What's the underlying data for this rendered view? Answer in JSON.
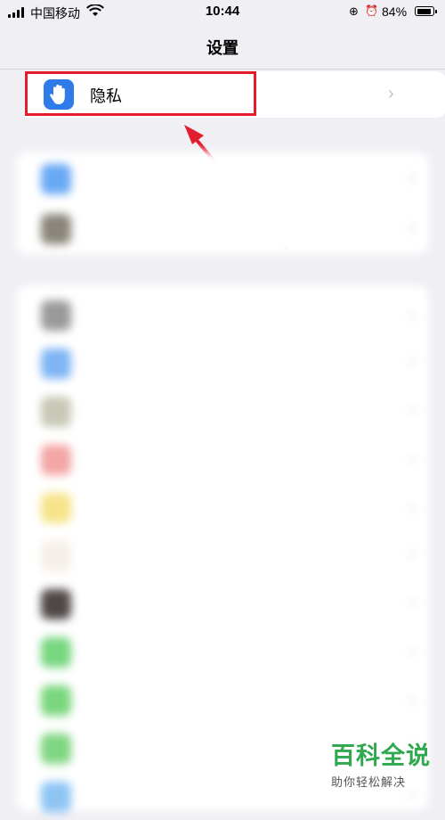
{
  "status_bar": {
    "carrier": "中国移动",
    "time": "10:44",
    "battery": "84%",
    "battery_fraction": 0.84
  },
  "nav": {
    "title": "设置"
  },
  "privacy_row": {
    "label": "隐私",
    "icon": "hand-icon",
    "icon_color": "#2f7bea"
  },
  "highlight_color": "#e31c2e",
  "blurred_sections": [
    {
      "items": [
        {
          "icon_color": "#69a8f5"
        },
        {
          "icon_color": "#8a857a"
        }
      ]
    },
    {
      "items": [
        {
          "icon_color": "#9a9a9a"
        },
        {
          "icon_color": "#7fb4f5"
        },
        {
          "icon_color": "#c8c8b6"
        },
        {
          "icon_color": "#f4a5a5"
        },
        {
          "icon_color": "#f7e48a"
        },
        {
          "icon_color": "#f6efe8"
        },
        {
          "icon_color": "#504848"
        },
        {
          "icon_color": "#78d680"
        },
        {
          "icon_color": "#7bd67e"
        },
        {
          "icon_color": "#7fd682"
        },
        {
          "icon_color": "#8dc4f4"
        }
      ]
    }
  ],
  "watermark": {
    "title": "百科全说",
    "subtitle": "助你轻松解决"
  }
}
